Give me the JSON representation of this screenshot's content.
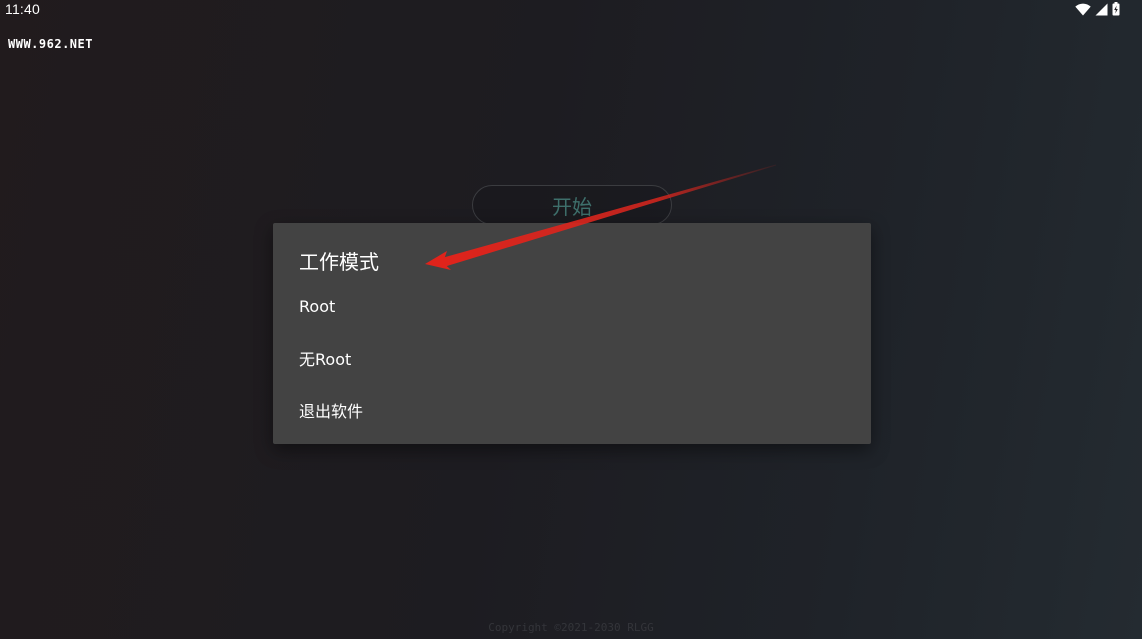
{
  "status_bar": {
    "time": "11:40",
    "icons": [
      "wifi-icon",
      "cellular-signal-icon",
      "battery-charging-icon"
    ]
  },
  "watermark": "WWW.962.NET",
  "main": {
    "start_button_label": "开始",
    "copyright": "Copyright ©2021-2030 RLGG"
  },
  "dialog": {
    "title": "工作模式",
    "options": [
      "Root",
      "无Root",
      "退出软件"
    ]
  },
  "colors": {
    "dialog_background": "#434343",
    "annotation_arrow": "#d8261e",
    "start_button_text": "#3e6f6b"
  }
}
